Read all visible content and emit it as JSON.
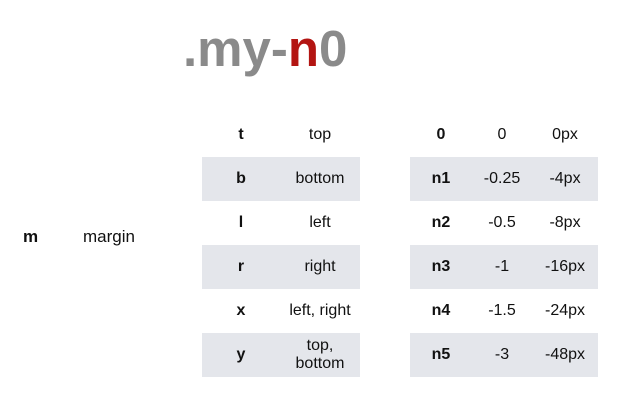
{
  "title": {
    "prefix": ".my-",
    "highlight": "n",
    "suffix": "0"
  },
  "property": {
    "abbr": "m",
    "name": "margin"
  },
  "sides": [
    {
      "key": "t",
      "label": "top"
    },
    {
      "key": "b",
      "label": "bottom"
    },
    {
      "key": "l",
      "label": "left"
    },
    {
      "key": "r",
      "label": "right"
    },
    {
      "key": "x",
      "label": "left, right"
    },
    {
      "key": "y",
      "label": "top, bottom"
    }
  ],
  "sizes": [
    {
      "key": "0",
      "rem": "0",
      "px": "0px"
    },
    {
      "key": "n1",
      "rem": "-0.25",
      "px": "-4px"
    },
    {
      "key": "n2",
      "rem": "-0.5",
      "px": "-8px"
    },
    {
      "key": "n3",
      "rem": "-1",
      "px": "-16px"
    },
    {
      "key": "n4",
      "rem": "-1.5",
      "px": "-24px"
    },
    {
      "key": "n5",
      "rem": "-3",
      "px": "-48px"
    }
  ],
  "colors": {
    "title_gray": "#8a8a8a",
    "title_accent": "#b31512",
    "row_shade": "#e4e6eb"
  }
}
